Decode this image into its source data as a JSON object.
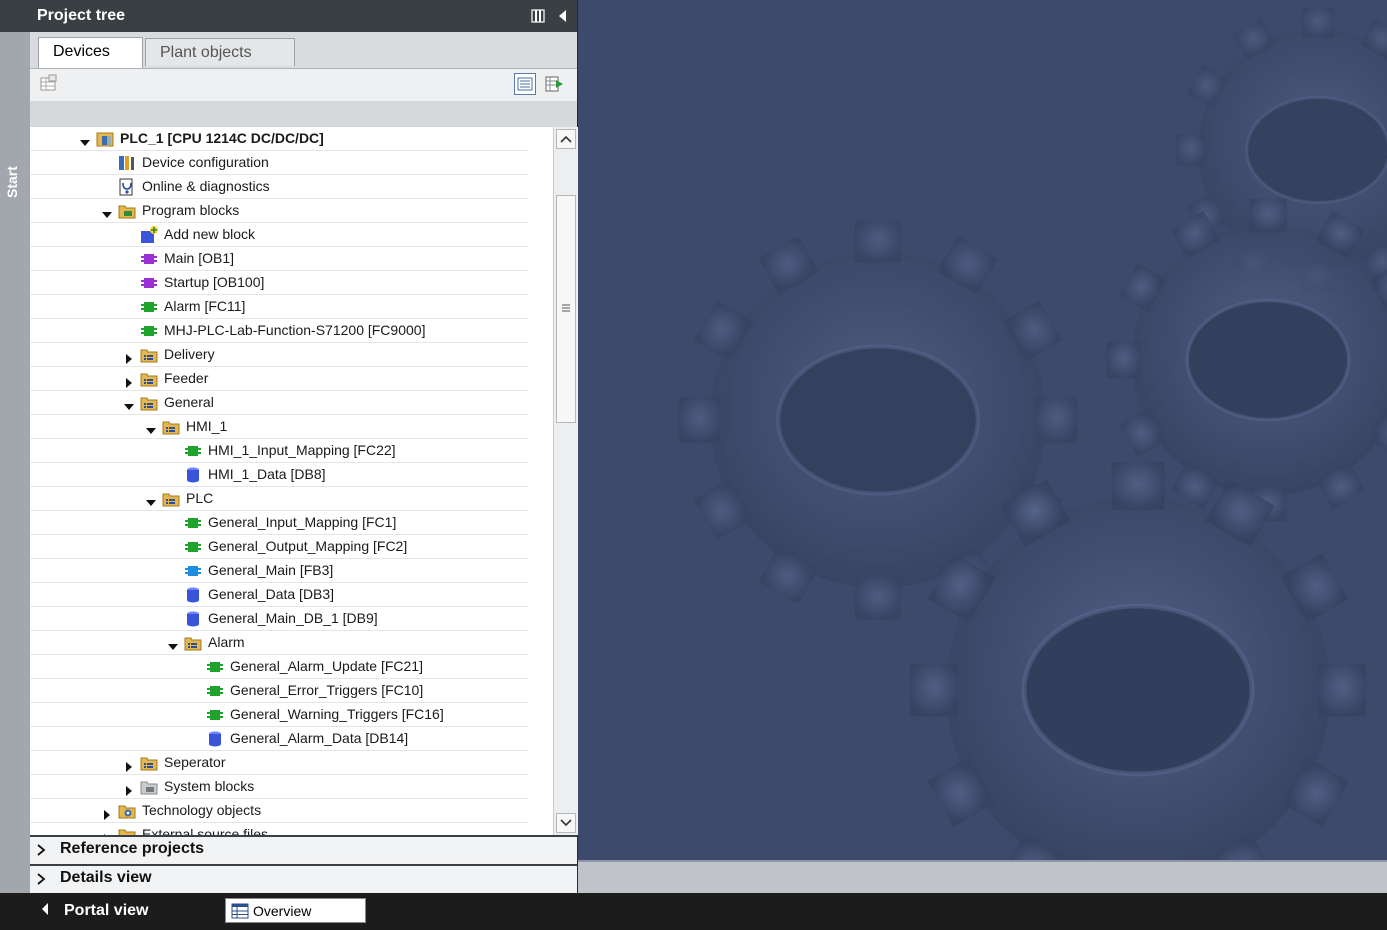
{
  "start_label": "Start",
  "project_tree": {
    "title": "Project tree",
    "tabs": [
      "Devices",
      "Plant objects"
    ]
  },
  "tree_items": [
    {
      "label": "PLC_1 [CPU 1214C DC/DC/DC]",
      "level": 0,
      "toggle": "expanded",
      "icon": "plc-icon",
      "bold": true
    },
    {
      "label": "Device configuration",
      "level": 1,
      "toggle": "none",
      "icon": "device-config-icon"
    },
    {
      "label": "Online & diagnostics",
      "level": 1,
      "toggle": "none",
      "icon": "diagnostics-icon"
    },
    {
      "label": "Program blocks",
      "level": 1,
      "toggle": "expanded",
      "icon": "program-blocks-folder-icon"
    },
    {
      "label": "Add new block",
      "level": 2,
      "toggle": "none",
      "icon": "add-block-icon"
    },
    {
      "label": "Main [OB1]",
      "level": 2,
      "toggle": "none",
      "icon": "ob-block-icon"
    },
    {
      "label": "Startup [OB100]",
      "level": 2,
      "toggle": "none",
      "icon": "ob-block-icon"
    },
    {
      "label": "Alarm [FC11]",
      "level": 2,
      "toggle": "none",
      "icon": "fc-block-icon"
    },
    {
      "label": "MHJ-PLC-Lab-Function-S71200 [FC9000]",
      "level": 2,
      "toggle": "none",
      "icon": "fc-block-icon"
    },
    {
      "label": "Delivery",
      "level": 2,
      "toggle": "collapsed",
      "icon": "group-folder-icon"
    },
    {
      "label": "Feeder",
      "level": 2,
      "toggle": "collapsed",
      "icon": "group-folder-icon"
    },
    {
      "label": "General",
      "level": 2,
      "toggle": "expanded",
      "icon": "group-folder-icon"
    },
    {
      "label": "HMI_1",
      "level": 3,
      "toggle": "expanded",
      "icon": "group-folder-icon"
    },
    {
      "label": "HMI_1_Input_Mapping [FC22]",
      "level": 4,
      "toggle": "none",
      "icon": "fc-block-icon"
    },
    {
      "label": "HMI_1_Data [DB8]",
      "level": 4,
      "toggle": "none",
      "icon": "db-block-icon"
    },
    {
      "label": "PLC",
      "level": 3,
      "toggle": "expanded",
      "icon": "group-folder-icon"
    },
    {
      "label": "General_Input_Mapping [FC1]",
      "level": 4,
      "toggle": "none",
      "icon": "fc-block-icon"
    },
    {
      "label": "General_Output_Mapping [FC2]",
      "level": 4,
      "toggle": "none",
      "icon": "fc-block-icon"
    },
    {
      "label": "General_Main [FB3]",
      "level": 4,
      "toggle": "none",
      "icon": "fb-block-icon"
    },
    {
      "label": "General_Data [DB3]",
      "level": 4,
      "toggle": "none",
      "icon": "db-block-icon"
    },
    {
      "label": "General_Main_DB_1 [DB9]",
      "level": 4,
      "toggle": "none",
      "icon": "db-block-icon"
    },
    {
      "label": "Alarm",
      "level": 4,
      "toggle": "expanded",
      "icon": "group-folder-icon"
    },
    {
      "label": "General_Alarm_Update [FC21]",
      "level": 5,
      "toggle": "none",
      "icon": "fc-block-icon"
    },
    {
      "label": "General_Error_Triggers [FC10]",
      "level": 5,
      "toggle": "none",
      "icon": "fc-block-icon"
    },
    {
      "label": "General_Warning_Triggers [FC16]",
      "level": 5,
      "toggle": "none",
      "icon": "fc-block-icon"
    },
    {
      "label": "General_Alarm_Data [DB14]",
      "level": 5,
      "toggle": "none",
      "icon": "db-block-icon"
    },
    {
      "label": "Seperator",
      "level": 2,
      "toggle": "collapsed",
      "icon": "group-folder-icon"
    },
    {
      "label": "System blocks",
      "level": 2,
      "toggle": "collapsed",
      "icon": "system-blocks-folder-icon"
    },
    {
      "label": "Technology objects",
      "level": 1,
      "toggle": "collapsed",
      "icon": "technology-objects-icon"
    },
    {
      "label": "External source files",
      "level": 1,
      "toggle": "collapsed",
      "icon": "group-folder-icon"
    }
  ],
  "sections": {
    "reference_projects": "Reference projects",
    "details_view": "Details view"
  },
  "bottom_bar": {
    "portal_view": "Portal view",
    "overview": "Overview"
  },
  "colors": {
    "header_dark": "#3a3f44",
    "workspace_blue": "#3e4a6b",
    "ob_block": "#9b2fd6",
    "fc_block": "#1fa32c",
    "fb_block": "#1e8fe0",
    "db_block": "#3a55d9",
    "folder": "#e6b84a"
  }
}
